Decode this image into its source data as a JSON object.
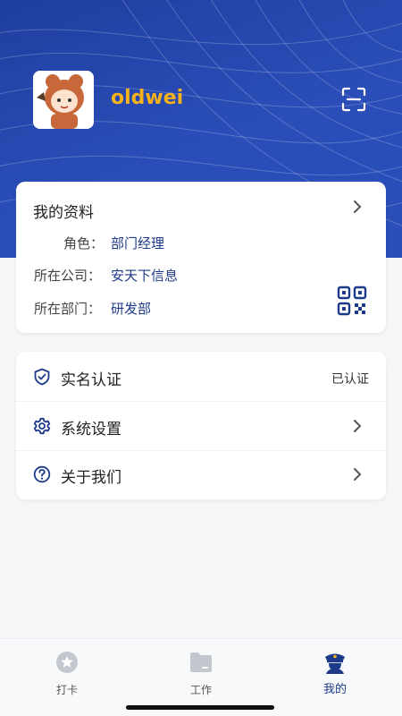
{
  "header": {
    "username": "oldwei"
  },
  "profile": {
    "title": "我的资料",
    "rows": [
      {
        "label": "角色：",
        "value": "部门经理"
      },
      {
        "label": "所在公司：",
        "value": "安天下信息"
      },
      {
        "label": "所在部门：",
        "value": "研发部"
      }
    ]
  },
  "menu": {
    "items": [
      {
        "label": "实名认证",
        "status": "已认证",
        "icon": "shield-check-icon"
      },
      {
        "label": "系统设置",
        "icon": "gear-icon"
      },
      {
        "label": "关于我们",
        "icon": "question-circle-icon"
      }
    ]
  },
  "tabbar": {
    "tabs": [
      {
        "label": "打卡",
        "icon": "star-badge-icon"
      },
      {
        "label": "工作",
        "icon": "folder-icon"
      },
      {
        "label": "我的",
        "icon": "police-officer-icon"
      }
    ],
    "active_index": 2
  },
  "colors": {
    "header_blue": "#2a4db8",
    "username_gold": "#f6b21b",
    "link_blue": "#1e3a8a"
  }
}
